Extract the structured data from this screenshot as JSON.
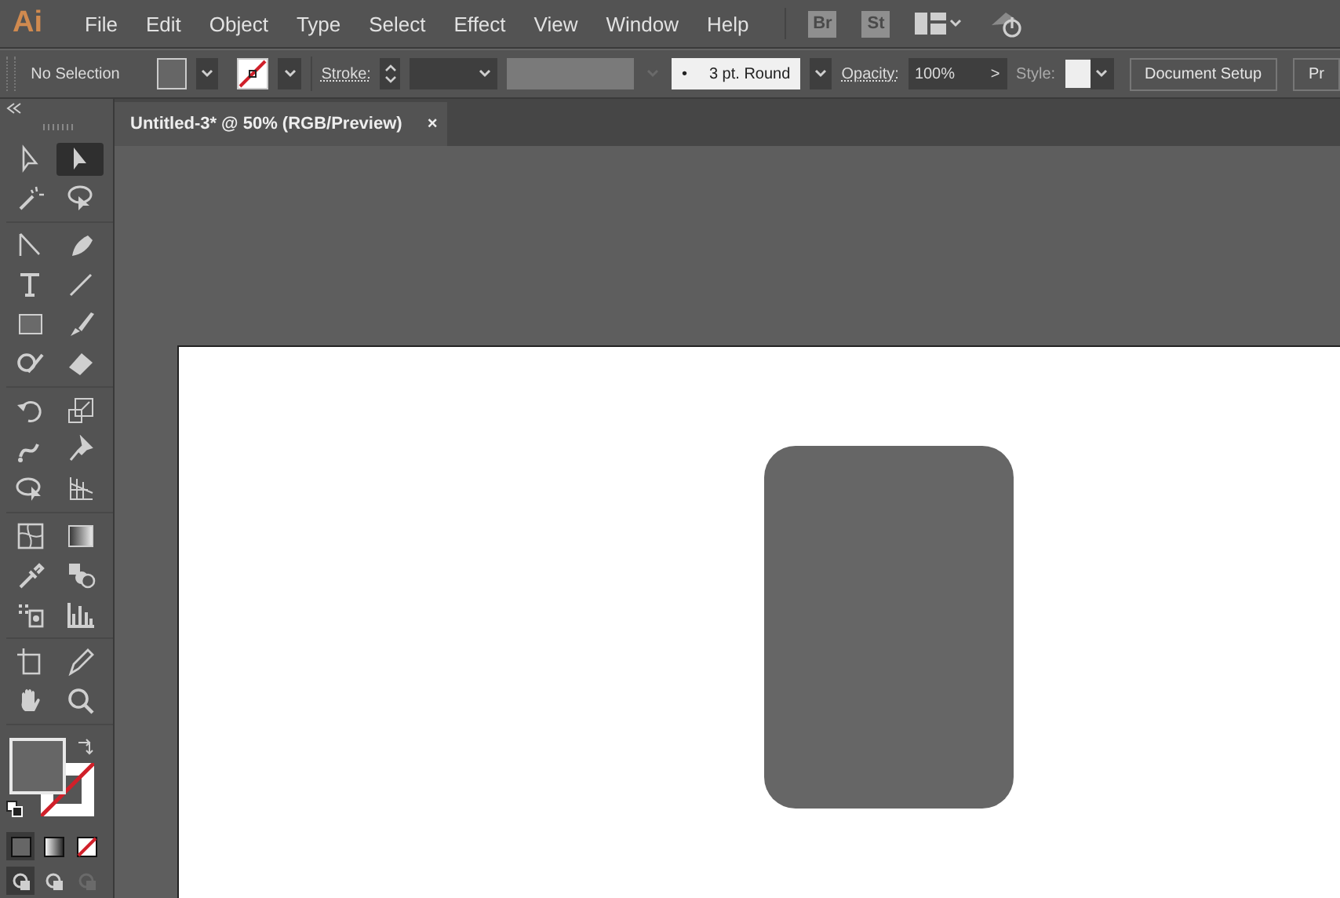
{
  "app": {
    "logo": "Ai"
  },
  "menu": [
    {
      "label": "File"
    },
    {
      "label": "Edit"
    },
    {
      "label": "Object"
    },
    {
      "label": "Type"
    },
    {
      "label": "Select"
    },
    {
      "label": "Effect"
    },
    {
      "label": "View"
    },
    {
      "label": "Window"
    },
    {
      "label": "Help"
    }
  ],
  "menubar_badges": [
    {
      "label": "Br"
    },
    {
      "label": "St"
    }
  ],
  "control_bar": {
    "selection": "No Selection",
    "stroke_label": "Stroke:",
    "brush": "3 pt. Round",
    "brush_dot": "•",
    "opacity_label": "Opacity:",
    "opacity": "100%",
    "opacity_arrow": ">",
    "style_label": "Style:",
    "buttons": [
      {
        "label": "Document Setup"
      },
      {
        "label": "Pr"
      }
    ]
  },
  "document_tab": {
    "title": "Untitled-3* @ 50% (RGB/Preview)",
    "close": "×",
    "selected": true
  },
  "tool_groups": [
    [
      {
        "kind": "selection",
        "selected": false
      },
      {
        "kind": "direct-selection",
        "selected": true
      },
      {
        "kind": "magic-wand",
        "selected": false
      },
      {
        "kind": "lasso",
        "selected": false
      }
    ],
    [
      {
        "kind": "curvature",
        "selected": false
      },
      {
        "kind": "pen",
        "selected": false
      },
      {
        "kind": "type",
        "selected": false
      },
      {
        "kind": "line",
        "selected": false
      },
      {
        "kind": "rectangle",
        "selected": false
      },
      {
        "kind": "paintbrush",
        "selected": false
      },
      {
        "kind": "shaper",
        "selected": false
      },
      {
        "kind": "eraser",
        "selected": false
      }
    ],
    [
      {
        "kind": "rotate",
        "selected": false
      },
      {
        "kind": "scale",
        "selected": false
      },
      {
        "kind": "warp",
        "selected": false
      },
      {
        "kind": "pin",
        "selected": false
      },
      {
        "kind": "free-transform",
        "selected": false
      },
      {
        "kind": "perspective",
        "selected": false
      }
    ],
    [
      {
        "kind": "mesh",
        "selected": false
      },
      {
        "kind": "gradient",
        "selected": false
      },
      {
        "kind": "eyedropper",
        "selected": false
      },
      {
        "kind": "blend",
        "selected": false
      },
      {
        "kind": "sprayer",
        "selected": false
      },
      {
        "kind": "graph",
        "selected": false
      }
    ],
    [
      {
        "kind": "artboard",
        "selected": false
      },
      {
        "kind": "slice",
        "selected": false
      },
      {
        "kind": "hand",
        "selected": false
      },
      {
        "kind": "zoom",
        "selected": false
      }
    ]
  ],
  "fill_stroke": {
    "fill": {
      "color": "#666666"
    },
    "stroke": {
      "none": true
    }
  },
  "canvas": {
    "shapes": [
      {
        "kind": "rounded-rectangle",
        "color": "#666666"
      }
    ]
  }
}
